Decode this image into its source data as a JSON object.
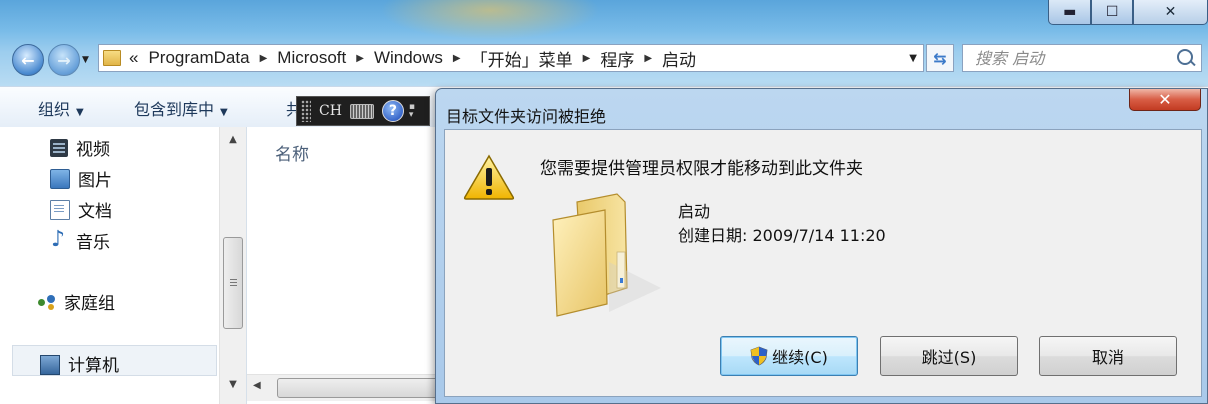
{
  "explorer": {
    "breadcrumb": {
      "overflow": "«",
      "items": [
        "ProgramData",
        "Microsoft",
        "Windows",
        "「开始」菜单",
        "程序",
        "启动"
      ]
    },
    "search": {
      "placeholder": "搜索 启动"
    },
    "toolbar": {
      "organize": "组织",
      "include_in_library": "包含到库中",
      "share_partial": "共"
    },
    "ime": {
      "lang": "CH",
      "help": "?"
    },
    "nav": {
      "items": [
        {
          "label": "视频",
          "icon": "video-icon"
        },
        {
          "label": "图片",
          "icon": "pictures-icon"
        },
        {
          "label": "文档",
          "icon": "documents-icon"
        },
        {
          "label": "音乐",
          "icon": "music-icon"
        },
        {
          "label": "家庭组",
          "icon": "homegroup-icon"
        },
        {
          "label": "计算机",
          "icon": "computer-icon"
        }
      ]
    },
    "content": {
      "column_name": "名称"
    }
  },
  "dialog": {
    "title": "目标文件夹访问被拒绝",
    "message": "您需要提供管理员权限才能移动到此文件夹",
    "folder_name": "启动",
    "created_label": "创建日期:",
    "created_value": "2009/7/14 11:20",
    "buttons": {
      "continue": "继续(C)",
      "skip": "跳过(S)",
      "cancel": "取消"
    }
  },
  "colors": {
    "dialog_frame": "#a9c9ea",
    "close_red": "#c23b22",
    "default_button": "#bee6fd",
    "warning_yellow": "#f5c518"
  }
}
